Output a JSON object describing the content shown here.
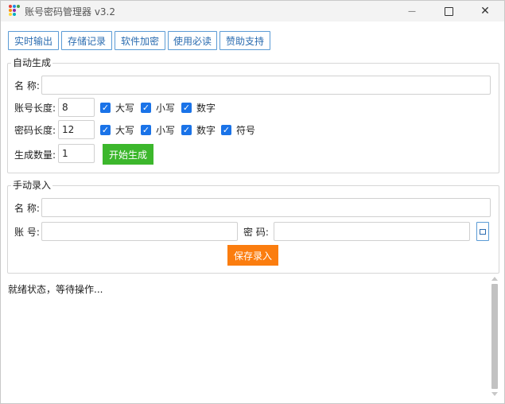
{
  "window": {
    "title": "账号密码管理器 v3.2",
    "controls": {
      "minimize": "—",
      "close": "✕"
    }
  },
  "toolbar": {
    "buttons": [
      "实时输出",
      "存储记录",
      "软件加密",
      "使用必读",
      "赞助支持"
    ]
  },
  "auto_gen": {
    "legend": "自动生成",
    "name_label": "名  称:",
    "name_value": "",
    "account_len_label": "账号长度:",
    "account_len_value": "8",
    "account_opts": [
      "大写",
      "小写",
      "数字"
    ],
    "password_len_label": "密码长度:",
    "password_len_value": "12",
    "password_opts": [
      "大写",
      "小写",
      "数字",
      "符号"
    ],
    "count_label": "生成数量:",
    "count_value": "1",
    "start_button": "开始生成"
  },
  "manual": {
    "legend": "手动录入",
    "name_label": "名  称:",
    "name_value": "",
    "account_label": "账  号:",
    "account_value": "",
    "password_label": "密  码:",
    "password_value": "",
    "save_button": "保存录入"
  },
  "status": {
    "text": "就绪状态，等待操作..."
  },
  "colors": {
    "accent_blue": "#1a73e8",
    "toolbar_border": "#5b9bd5",
    "start_green": "#3cb72c",
    "save_orange": "#fb7d0f"
  },
  "icons": {
    "checkbox": "check-icon",
    "paste": "paste-icon"
  }
}
